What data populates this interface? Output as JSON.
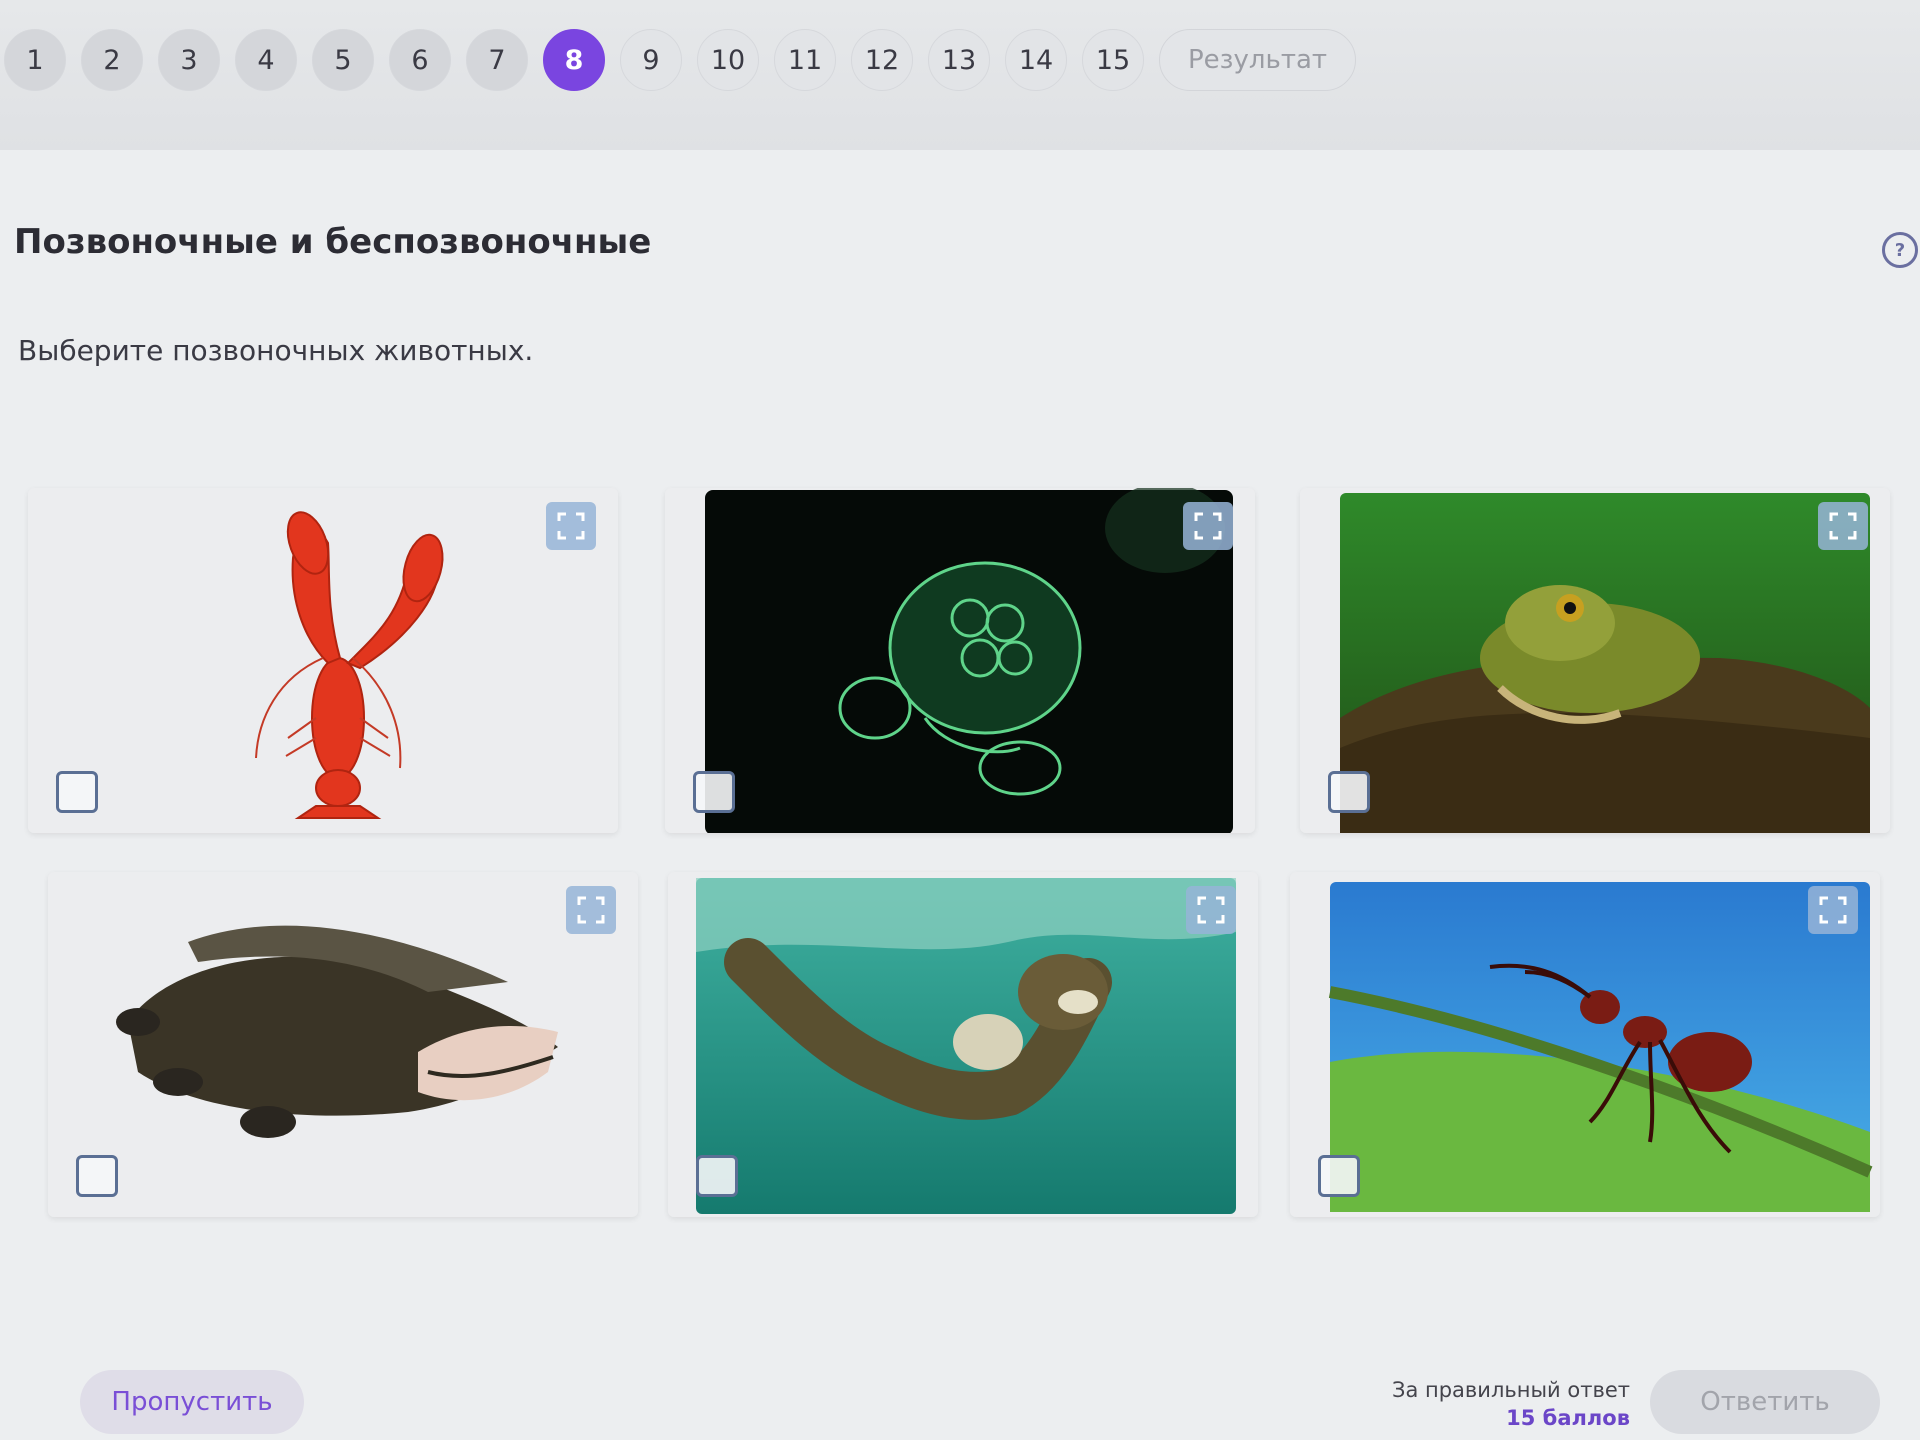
{
  "pager": {
    "pages": [
      "1",
      "2",
      "3",
      "4",
      "5",
      "6",
      "7",
      "8",
      "9",
      "10",
      "11",
      "12",
      "13",
      "14",
      "15"
    ],
    "active": "8",
    "result_label": "Результат"
  },
  "task": {
    "title": "Позвоночные и беспозвоночные",
    "instruction": "Выберите позвоночных животных.",
    "help_icon": "question-icon"
  },
  "options": [
    {
      "animal": "lobster",
      "checked": false
    },
    {
      "animal": "jellyfish",
      "checked": false
    },
    {
      "animal": "frog",
      "checked": false
    },
    {
      "animal": "crocodile",
      "checked": false
    },
    {
      "animal": "otter",
      "checked": false
    },
    {
      "animal": "ant",
      "checked": false
    }
  ],
  "footer": {
    "skip_label": "Пропустить",
    "score_label": "За правильный ответ",
    "score_points": "15 баллов",
    "answer_label": "Ответить"
  },
  "colors": {
    "accent": "#7a45e0",
    "background": "#eceef0"
  }
}
